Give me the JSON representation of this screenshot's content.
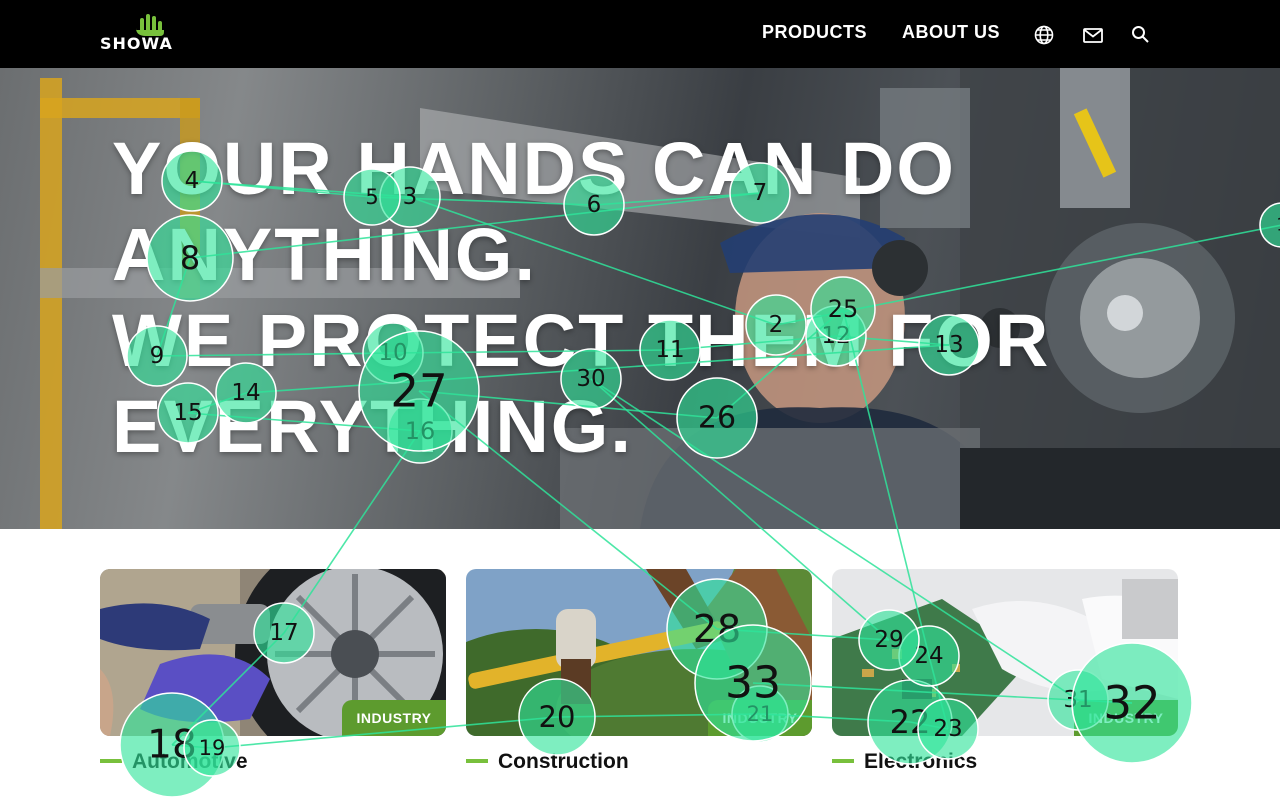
{
  "brand": {
    "logo_text": "SHOWA",
    "accent_green": "#78c03c",
    "badge_green": "#5d9b2e"
  },
  "nav": {
    "products_label": "PRODUCTS",
    "about_label": "ABOUT US",
    "globe_icon": "globe-icon",
    "mail_icon": "mail-icon",
    "search_icon": "search-icon"
  },
  "hero": {
    "lines": [
      "YOUR HANDS CAN DO",
      "ANYTHING.",
      "WE PROTECT THEM FOR",
      "EVERYTHING."
    ]
  },
  "cards": [
    {
      "badge": "INDUSTRY",
      "label": "Automotive"
    },
    {
      "badge": "INDUSTRY",
      "label": "Construction"
    },
    {
      "badge": "INDUSTRY",
      "label": "Electronics"
    }
  ],
  "gaze": {
    "color": "#2fe39a",
    "fixation_labels": [
      "1",
      "2",
      "3",
      "4",
      "5",
      "6",
      "7",
      "8",
      "9",
      "10",
      "11",
      "12",
      "13",
      "14",
      "15",
      "16",
      "17",
      "18",
      "19",
      "20",
      "21",
      "22",
      "23",
      "24",
      "25",
      "26",
      "27",
      "28",
      "29",
      "30",
      "31",
      "32",
      "33"
    ]
  }
}
